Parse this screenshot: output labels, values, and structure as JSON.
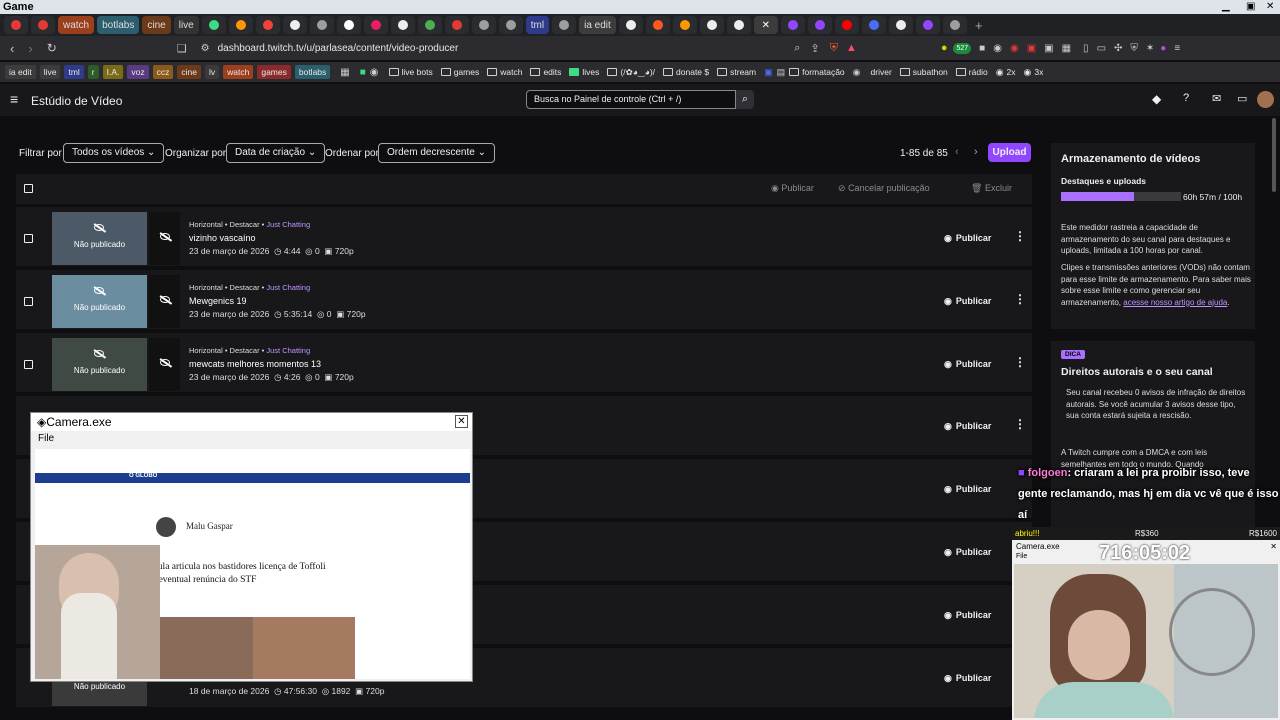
{
  "window": {
    "title": "Game"
  },
  "tabs": [
    {
      "label": "watch",
      "color": "#9c3f1c"
    },
    {
      "label": "botlabs",
      "color": "#2b5f6d"
    },
    {
      "label": "cine",
      "color": "#6a3a1a"
    },
    {
      "label": "live",
      "color": "#333"
    },
    {
      "label": "tml",
      "color": "#2e3b8a"
    },
    {
      "label": "ia edit",
      "color": "#3c3c3c"
    }
  ],
  "address": {
    "url": "dashboard.twitch.tv/u/parlasea/content/video-producer",
    "badge": "527"
  },
  "bookmarks": {
    "tags": [
      {
        "label": "ia edit",
        "color": "#3c3c3c"
      },
      {
        "label": "live",
        "color": "#3c3c3c"
      },
      {
        "label": "tml",
        "color": "#2e3b8a"
      },
      {
        "label": "r",
        "color": "#2c5c2c"
      },
      {
        "label": "I.A.",
        "color": "#7a6a1a"
      },
      {
        "label": "voz",
        "color": "#5a3a80"
      },
      {
        "label": "ccz",
        "color": "#8a5a1a"
      },
      {
        "label": "cine",
        "color": "#6a3a1a"
      },
      {
        "label": "lv",
        "color": "#3a3a3a"
      },
      {
        "label": "watch",
        "color": "#9c3f1c"
      },
      {
        "label": "games",
        "color": "#8a2a2a"
      },
      {
        "label": "botlabs",
        "color": "#2b5f6d"
      }
    ],
    "folders": [
      "(/✿◕‿◕)/",
      "live bots",
      "games",
      "watch",
      "edits",
      "lives",
      "(/✿◕‿◕)/",
      "donate $",
      "stream",
      "formatação",
      "driver",
      "subathon",
      "rádio",
      "2x",
      "3x"
    ]
  },
  "studio": {
    "menu_label": "Estúdio de Vídeo",
    "search_placeholder": "Busca no Painel de controle (Ctrl + /)"
  },
  "filters": {
    "filter_label": "Filtrar por",
    "filter_value": "Todos os vídeos",
    "organize_label": "Organizar por",
    "organize_value": "Data de criação",
    "order_label": "Ordenar por",
    "order_value": "Ordem decrescente",
    "pagination": "1-85 de 85",
    "upload": "Upload"
  },
  "bulk": {
    "publish": "Publicar",
    "unpublish": "Cancelar publicação",
    "delete": "Excluir"
  },
  "publish_label": "Publicar",
  "videos": [
    {
      "meta": "Horizontal • Destacar • ",
      "category": "Just Chatting",
      "title": "vizinho vascaíno",
      "date": "23 de março de 2026",
      "duration": "4:44",
      "views": "0",
      "quality": "720p",
      "status": "Não publicado"
    },
    {
      "meta": "Horizontal • Destacar • ",
      "category": "Just Chatting",
      "title": "Mewgenics 19",
      "date": "23 de março de 2026",
      "duration": "5:35:14",
      "views": "0",
      "quality": "720p",
      "status": "Não publicado"
    },
    {
      "meta": "Horizontal • Destacar • ",
      "category": "Just Chatting",
      "title": "mewcats melhores momentos 13",
      "date": "23 de março de 2026",
      "duration": "4:26",
      "views": "0",
      "quality": "720p",
      "status": "Não publicado"
    },
    {
      "date": "18 de março de 2026",
      "duration": "47:56:30",
      "views": "1892",
      "quality": "720p",
      "status": "Não publicado"
    }
  ],
  "storage": {
    "title": "Armazenamento de vídeos",
    "subtitle": "Destaques e uploads",
    "usage": "60h 57m / 100h",
    "fraction": 0.61,
    "desc1": "Este medidor rastreia a capacidade de armazenamento do seu canal para destaques e uploads, limitada a 100 horas por canal.",
    "desc2": "Clipes e transmissões anteriores (VODs) não contam para esse limite de armazenamento. Para saber mais sobre esse limite e como gerenciar seu armazenamento,",
    "link": "acesse nosso artigo de ajuda",
    "period": "."
  },
  "tip": {
    "badge": "DICA",
    "title": "Direitos autorais e o seu canal",
    "text": "Seu canal recebeu 0 avisos de infração de direitos autorais. Se você acumular 3 avisos desse tipo, sua conta estará sujeita a rescisão.",
    "text2": "A Twitch cumpre com a DMCA e com leis semelhantes em todo o mundo. Quando"
  },
  "chat_overlay": {
    "user": "folgoen",
    "message": "criaram a lei pra proibir isso, teve gente reclamando, mas hj em dia vc vê que é isso aí"
  },
  "camera_window": {
    "title": "Camera.exe",
    "menu": "File",
    "article_author": "Malu Gaspar",
    "article_headline": "Lula articula nos bastidores licença de Toffoli e eventual renúncia do STF",
    "site": "O GLOBO"
  },
  "subathon": {
    "goal_label": "abriu!!!",
    "amount1": "R$360",
    "amount2": "R$1600",
    "timer": "716:05:02",
    "window_title": "Camera.exe",
    "menu": "File"
  }
}
